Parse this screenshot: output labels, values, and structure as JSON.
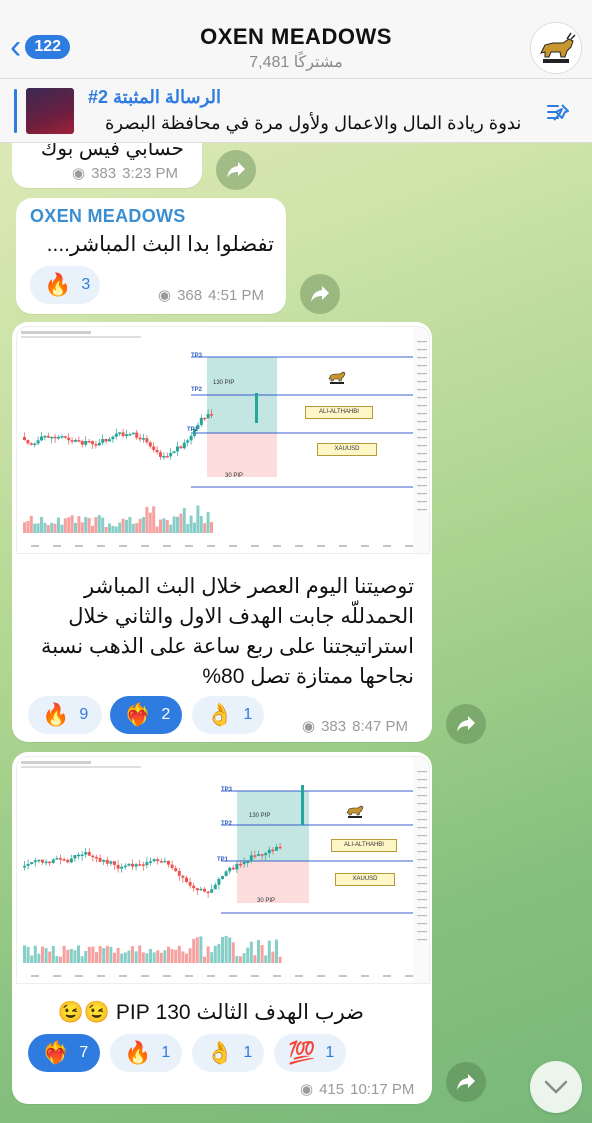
{
  "header": {
    "back_count": "122",
    "title": "OXEN MEADOWS",
    "subscribers": "7,481 مشتركًا"
  },
  "pinned": {
    "title": "#2 الرسالة المثبتة",
    "text": "ندوة ريادة المال والاعمال ولأول مرة في محافظة البصرة"
  },
  "messages": [
    {
      "partial_text": "حسابي فيس بوك",
      "views": "383",
      "time": "3:23 PM"
    },
    {
      "sender": "OXEN MEADOWS",
      "text": "تفضلوا بدا البث المباشر....",
      "reactions": [
        {
          "emoji": "🔥",
          "count": "3"
        }
      ],
      "views": "368",
      "time": "4:51 PM"
    },
    {
      "chart": {
        "tp3": "TP3",
        "tp2": "TP2",
        "tp1": "TP1",
        "pip_target": "130 PIP",
        "pip_stop": "30 PIP",
        "label1": "ALI-ALTHAHBI",
        "label2": "XAUUSD"
      },
      "text_lines": [
        "توصيتنا اليوم العصر خلال البث المباشر",
        "الحمدللّه جابت الهدف الاول والثاني خلال",
        "استراتيجتنا على ربع ساعة على الذهب نسبة",
        "نجاحها ممتازة تصل 80%"
      ],
      "reactions": [
        {
          "emoji": "🔥",
          "count": "9",
          "selected": false
        },
        {
          "emoji": "❤️‍🔥",
          "count": "2",
          "selected": true
        },
        {
          "emoji": "👌",
          "count": "1",
          "selected": false
        }
      ],
      "views": "383",
      "time": "8:47 PM"
    },
    {
      "chart": {
        "tp3": "TP3",
        "tp2": "TP2",
        "tp1": "TP1",
        "pip_target": "130 PIP",
        "pip_stop": "30 PIP",
        "label1": "ALI-ALTHAHBI",
        "label2": "XAUUSD"
      },
      "text": "ضرب الهدف الثالث 130 PIP 😉😉",
      "reactions": [
        {
          "emoji": "❤️‍🔥",
          "count": "7",
          "selected": true
        },
        {
          "emoji": "🔥",
          "count": "1",
          "selected": false
        },
        {
          "emoji": "👌",
          "count": "1",
          "selected": false
        },
        {
          "emoji": "💯",
          "count": "1",
          "selected": false
        }
      ],
      "views": "415",
      "time": "10:17 PM"
    }
  ],
  "colors": {
    "accent": "#2f7ce0",
    "bull": "#26a69a",
    "bear": "#ef5350"
  }
}
